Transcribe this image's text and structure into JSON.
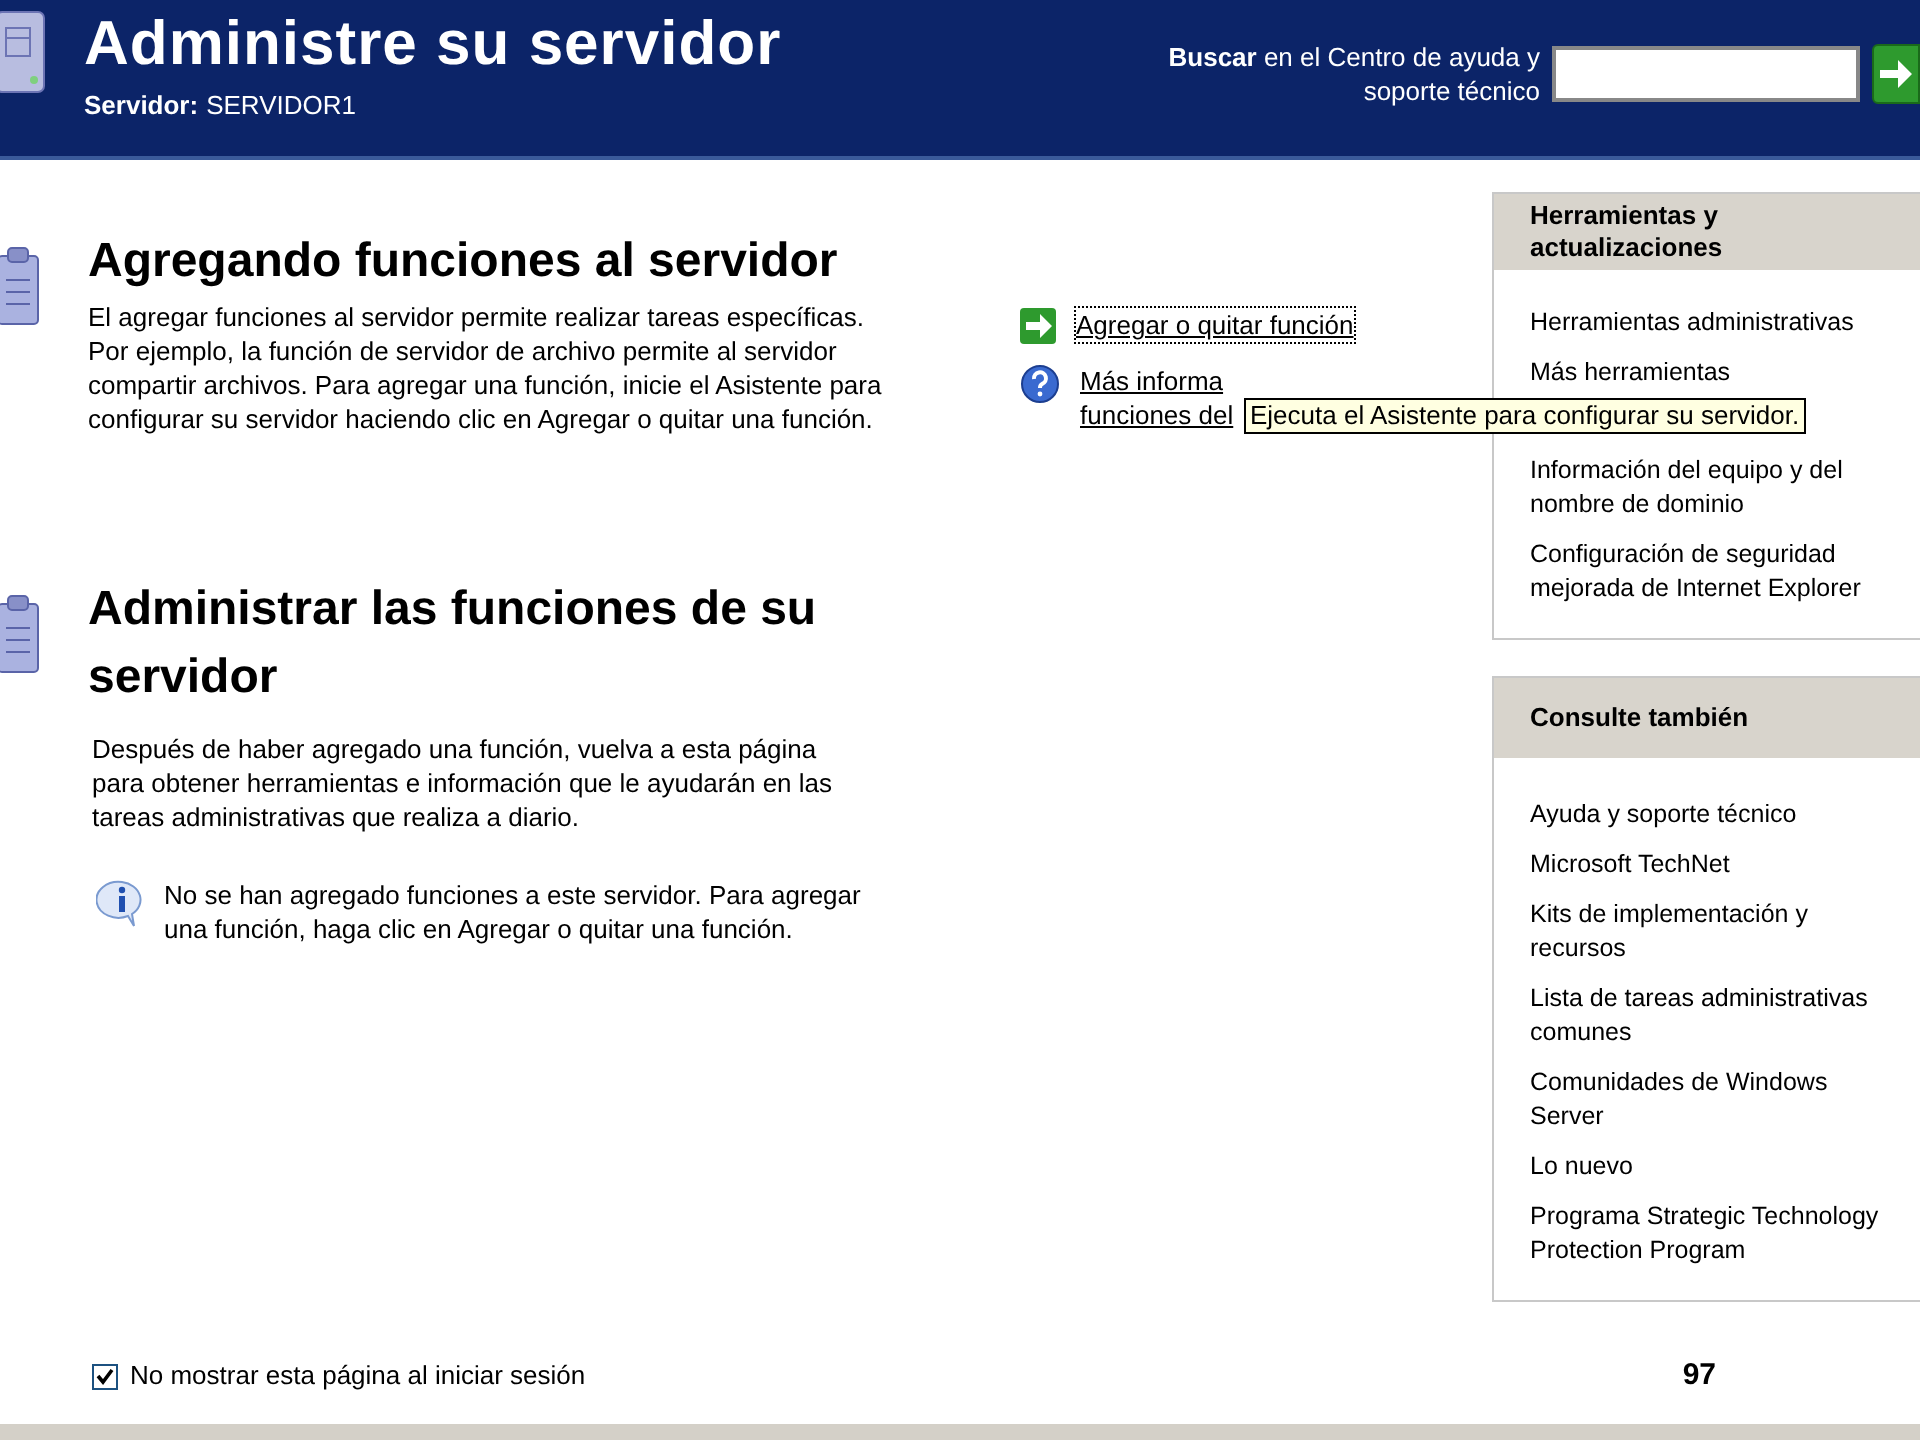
{
  "header": {
    "title": "Administre su servidor",
    "server_label": "Servidor:",
    "server_name": "SERVIDOR1",
    "search_bold": "Buscar",
    "search_text": "en el Centro de ayuda y\nsoporte técnico"
  },
  "sections": [
    {
      "kind": "add",
      "title": "Agregando funciones al servidor",
      "body": "El agregar funciones al servidor permite realizar tareas específicas.\nPor ejemplo, la función de servidor de archivo permite al servidor\ncompartir archivos. Para agregar una función, inicie el Asistente para\nconfigurar su servidor haciendo clic en Agregar o quitar una función.",
      "links": [
        {
          "kind": "arrow",
          "text": "Agregar o quitar función",
          "focused": true
        },
        {
          "kind": "help",
          "text": "Más informa\nfunciones del",
          "focused": false
        }
      ]
    },
    {
      "kind": "manage",
      "title": "Administrar las funciones de su servidor",
      "body": "Después de haber agregado una función, vuelva a esta página\npara obtener herramientas e información que le ayudarán en las\ntareas administrativas que realiza a diario.",
      "note": "No se han agregado funciones a este servidor. Para agregar\nuna función, haga clic en Agregar o quitar una función."
    }
  ],
  "tooltip": "Ejecuta el Asistente para configurar su servidor.",
  "sidebar": [
    {
      "title": "Herramientas y actualizaciones",
      "items": [
        "Herramientas administrativas",
        "Más herramientas",
        "Información del equipo y del\nnombre de dominio",
        "Configuración de seguridad\nmejorada de Internet Explorer"
      ]
    },
    {
      "title": "Consulte también",
      "items": [
        "Ayuda y soporte técnico",
        "Microsoft TechNet",
        "Kits de implementación y\nrecursos",
        "Lista de tareas administrativas\ncomunes",
        "Comunidades de Windows\nServer",
        "Lo nuevo",
        "Programa Strategic Technology\nProtection Program"
      ]
    }
  ],
  "footer": {
    "checkbox": {
      "label": "No mostrar esta página al iniciar sesión",
      "checked": true
    },
    "page_number": "97"
  }
}
